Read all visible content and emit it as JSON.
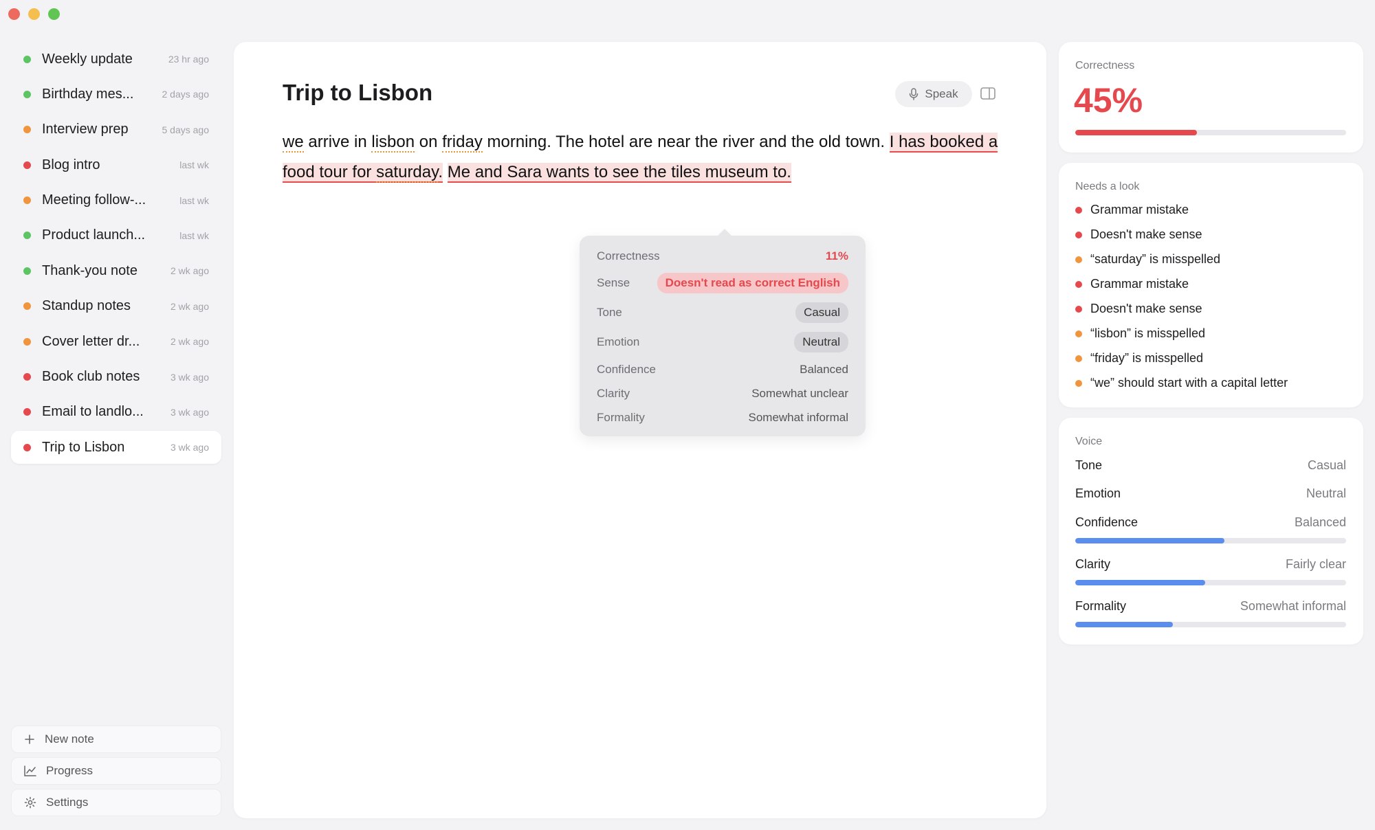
{
  "window": {
    "traffic_lights": [
      "close",
      "minimize",
      "maximize"
    ]
  },
  "colors": {
    "green": "#5cc463",
    "orange": "#f0953d",
    "red": "#e5484d",
    "blue": "#5b8def"
  },
  "sidebar": {
    "items": [
      {
        "label": "Weekly update",
        "time": "23 hr ago",
        "status": "green"
      },
      {
        "label": "Birthday mes...",
        "time": "2 days ago",
        "status": "green"
      },
      {
        "label": "Interview prep",
        "time": "5 days ago",
        "status": "orange"
      },
      {
        "label": "Blog intro",
        "time": "last wk",
        "status": "red"
      },
      {
        "label": "Meeting follow-...",
        "time": "last wk",
        "status": "orange"
      },
      {
        "label": "Product launch...",
        "time": "last wk",
        "status": "green"
      },
      {
        "label": "Thank-you note",
        "time": "2 wk ago",
        "status": "green"
      },
      {
        "label": "Standup notes",
        "time": "2 wk ago",
        "status": "orange"
      },
      {
        "label": "Cover letter dr...",
        "time": "2 wk ago",
        "status": "orange"
      },
      {
        "label": "Book club notes",
        "time": "3 wk ago",
        "status": "red"
      },
      {
        "label": "Email to landlo...",
        "time": "3 wk ago",
        "status": "red"
      },
      {
        "label": "Trip to Lisbon",
        "time": "3 wk ago",
        "status": "red",
        "active": true
      }
    ],
    "new_note": "New note",
    "progress": "Progress",
    "settings": "Settings"
  },
  "editor": {
    "title": "Trip to Lisbon",
    "speak_label": "Speak",
    "text": {
      "w1": "we",
      "t1": " arrive in ",
      "w2": "lisbon",
      "t2": " on ",
      "w3": "friday",
      "t3": " morning. The hotel are near the river and the old town. ",
      "s1a": "I has booked a food tour for ",
      "s1b": "saturday",
      "s1c": ".",
      "t4": " ",
      "s2": "Me and Sara wants to see the tiles museum to."
    }
  },
  "popover": {
    "correctness_label": "Correctness",
    "correctness_value": "11%",
    "sense_label": "Sense",
    "sense_value": "Doesn't read as correct English",
    "tone_label": "Tone",
    "tone_value": "Casual",
    "emotion_label": "Emotion",
    "emotion_value": "Neutral",
    "confidence_label": "Confidence",
    "confidence_value": "Balanced",
    "clarity_label": "Clarity",
    "clarity_value": "Somewhat unclear",
    "formality_label": "Formality",
    "formality_value": "Somewhat informal"
  },
  "correctness_card": {
    "title": "Correctness",
    "value": "45%",
    "fraction": 0.45
  },
  "needs_look": {
    "title": "Needs a look",
    "items": [
      {
        "text": "Grammar mistake",
        "severity": "red"
      },
      {
        "text": "Doesn't make sense",
        "severity": "red"
      },
      {
        "text": "“saturday” is misspelled",
        "severity": "orange"
      },
      {
        "text": "Grammar mistake",
        "severity": "red"
      },
      {
        "text": "Doesn't make sense",
        "severity": "red"
      },
      {
        "text": "“lisbon” is misspelled",
        "severity": "orange"
      },
      {
        "text": "“friday” is misspelled",
        "severity": "orange"
      },
      {
        "text": "“we” should start with a capital letter",
        "severity": "orange"
      }
    ]
  },
  "voice": {
    "title": "Voice",
    "tone_label": "Tone",
    "tone_value": "Casual",
    "emotion_label": "Emotion",
    "emotion_value": "Neutral",
    "confidence_label": "Confidence",
    "confidence_value": "Balanced",
    "confidence_level": 0.55,
    "clarity_label": "Clarity",
    "clarity_value": "Fairly clear",
    "clarity_level": 0.48,
    "formality_label": "Formality",
    "formality_value": "Somewhat informal",
    "formality_level": 0.36
  }
}
